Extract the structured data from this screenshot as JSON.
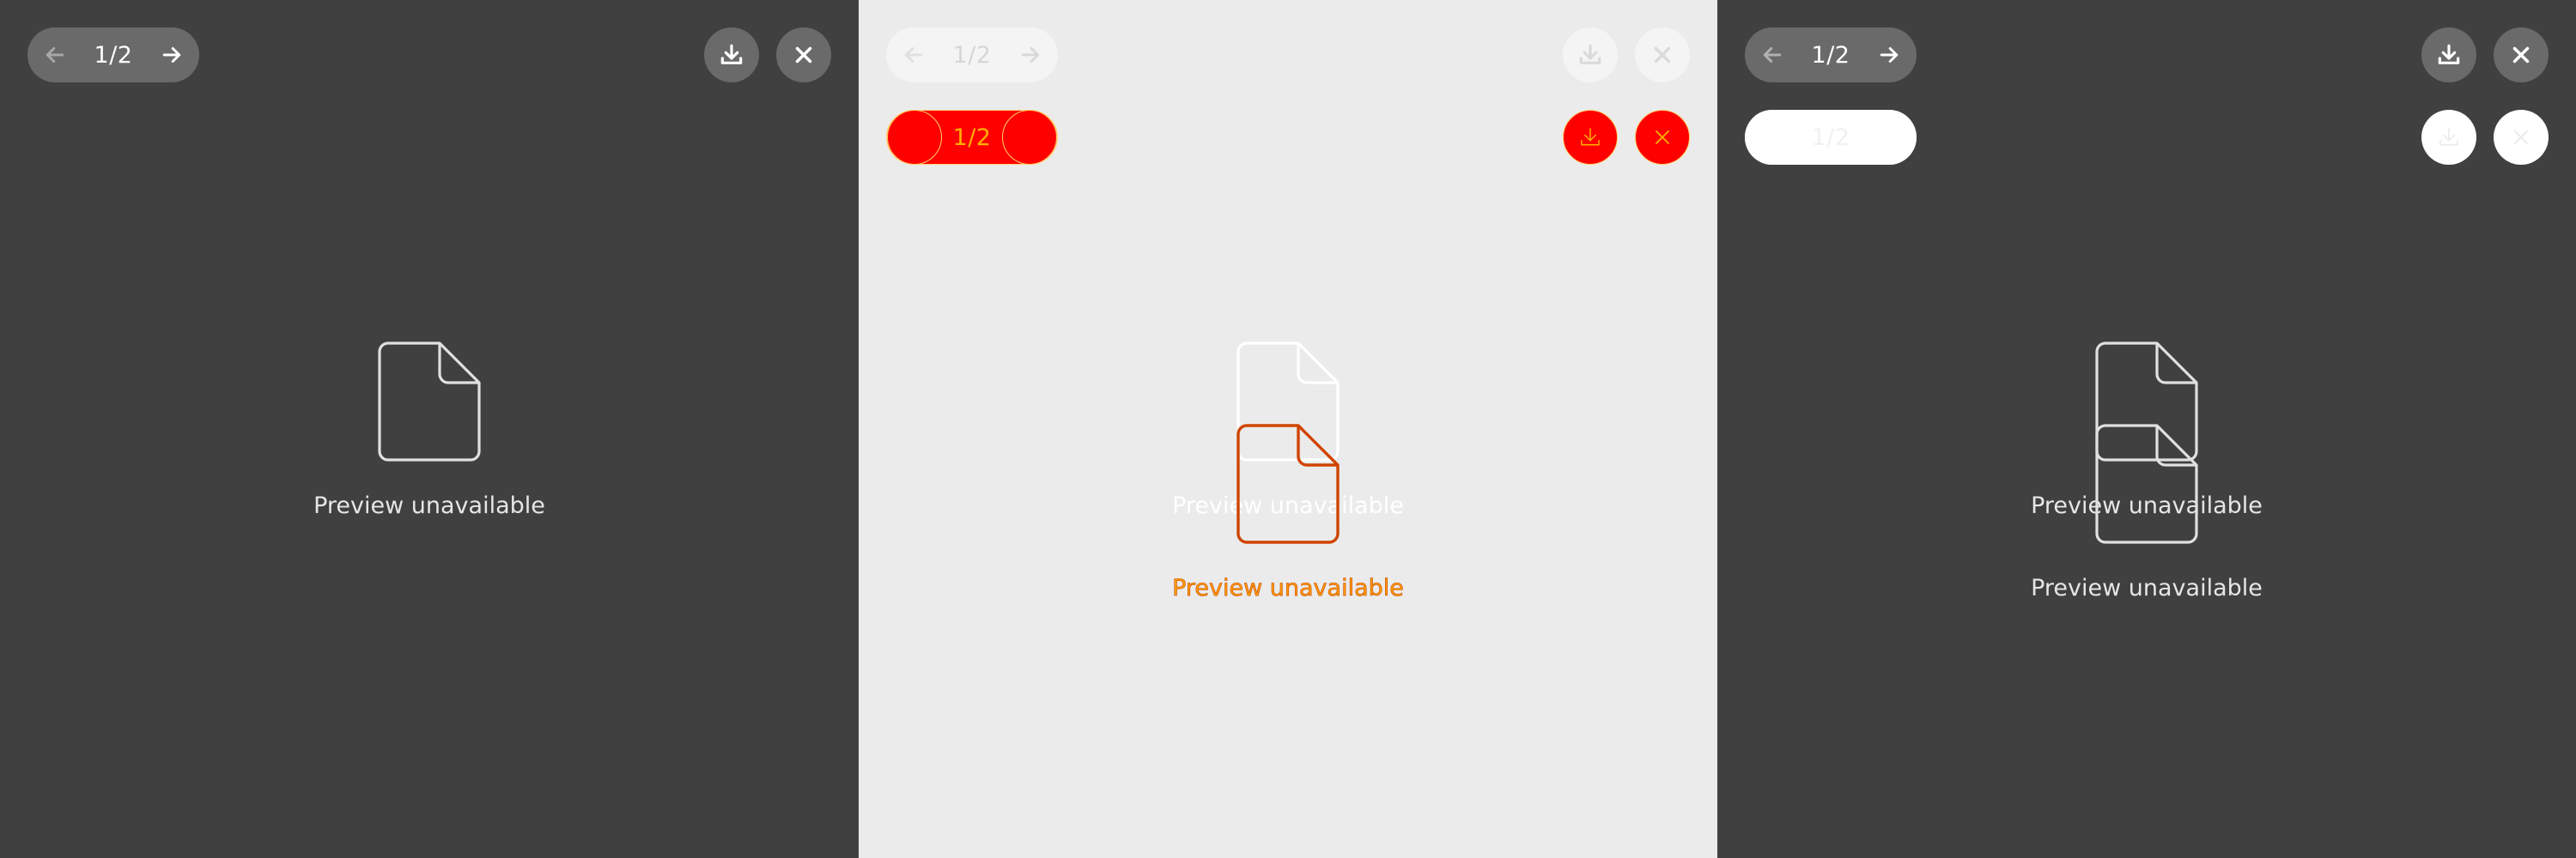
{
  "viewer": {
    "page_counter": "1/2",
    "preview_message": "Preview unavailable"
  },
  "icons": {
    "prev": "arrow-left-icon",
    "next": "arrow-right-icon",
    "download": "download-icon",
    "close": "close-icon",
    "file": "file-icon"
  },
  "colors": {
    "dark_background": "#404040",
    "light_background": "#ebebeb",
    "control_fill": "#6a6a6a",
    "highlight_red": "#ff0000",
    "highlight_text": "#ff9a00",
    "highlight_stroke": "#c84a00"
  }
}
